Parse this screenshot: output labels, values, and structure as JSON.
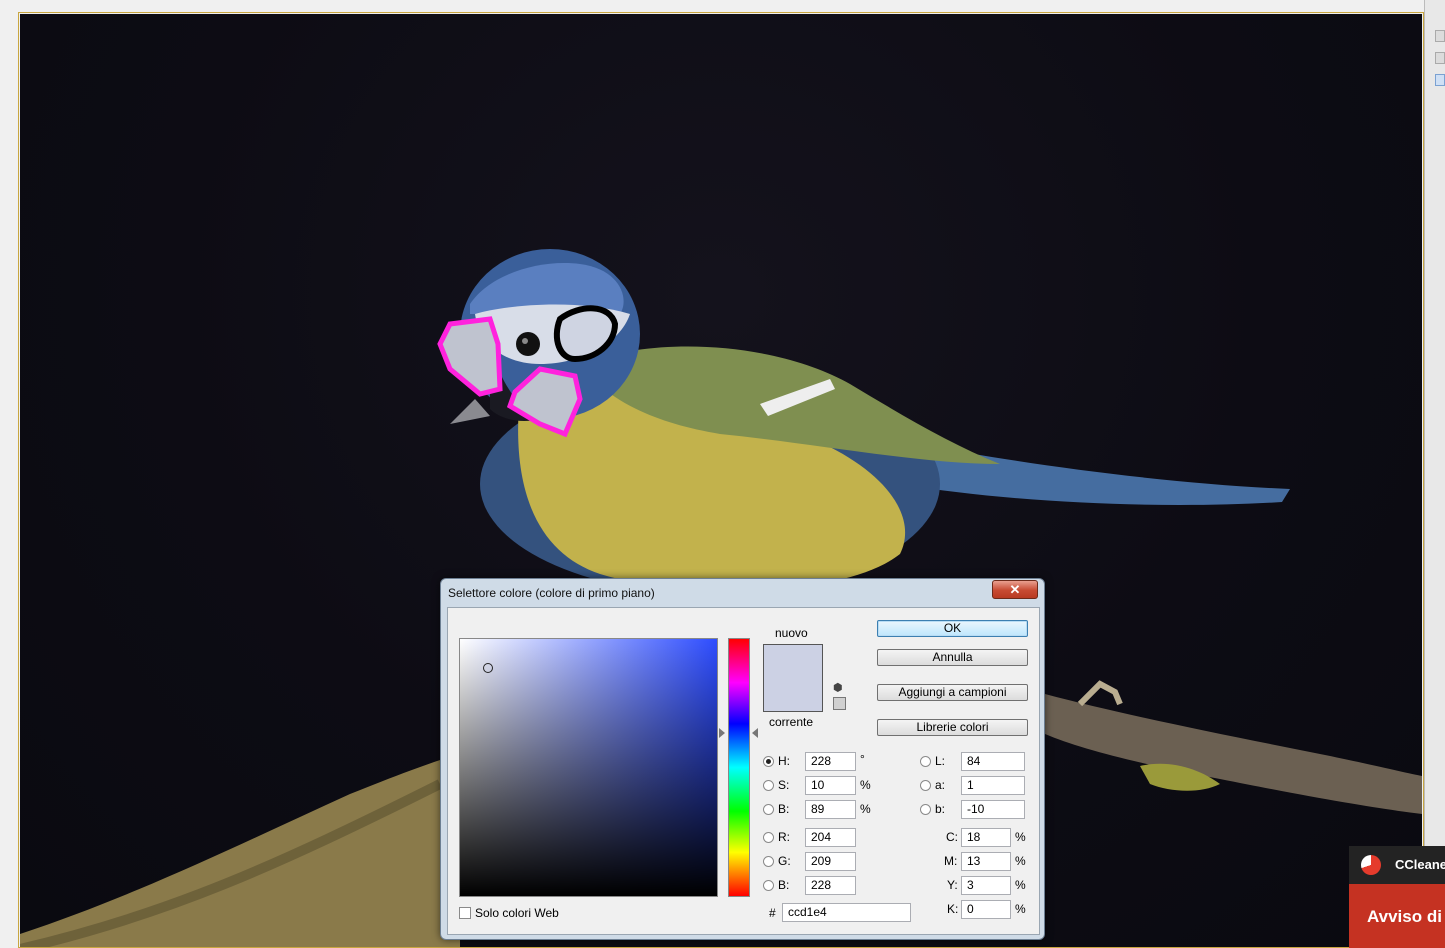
{
  "dialog": {
    "title": "Selettore colore (colore di primo piano)",
    "close_glyph": "✕",
    "new_label": "nuovo",
    "current_label": "corrente",
    "new_color": "#ccd1e4",
    "current_color": "#ccd1e4",
    "buttons": {
      "ok": "OK",
      "cancel": "Annulla",
      "add_swatch": "Aggiungi a campioni",
      "color_libraries": "Librerie colori"
    },
    "hsb": {
      "h_label": "H:",
      "h_value": "228",
      "h_unit": "°",
      "s_label": "S:",
      "s_value": "10",
      "s_unit": "%",
      "b_label": "B:",
      "b_value": "89",
      "b_unit": "%"
    },
    "rgb": {
      "r_label": "R:",
      "r_value": "204",
      "g_label": "G:",
      "g_value": "209",
      "b_label": "B:",
      "b_value": "228"
    },
    "lab": {
      "l_label": "L:",
      "l_value": "84",
      "a_label": "a:",
      "a_value": "1",
      "b_label": "b:",
      "b_value": "-10"
    },
    "cmyk": {
      "c_label": "C:",
      "c_value": "18",
      "c_unit": "%",
      "m_label": "M:",
      "m_value": "13",
      "m_unit": "%",
      "y_label": "Y:",
      "y_value": "3",
      "y_unit": "%",
      "k_label": "K:",
      "k_value": "0",
      "k_unit": "%"
    },
    "hex_label": "#",
    "hex_value": "ccd1e4",
    "web_only_label": "Solo colori Web"
  },
  "notification": {
    "app_name": "CCleaner",
    "message": "Avviso di"
  },
  "photo": {
    "subject": "blue tit bird on branch",
    "annotation_color": "#ff22dd",
    "outline_color": "#000000"
  }
}
